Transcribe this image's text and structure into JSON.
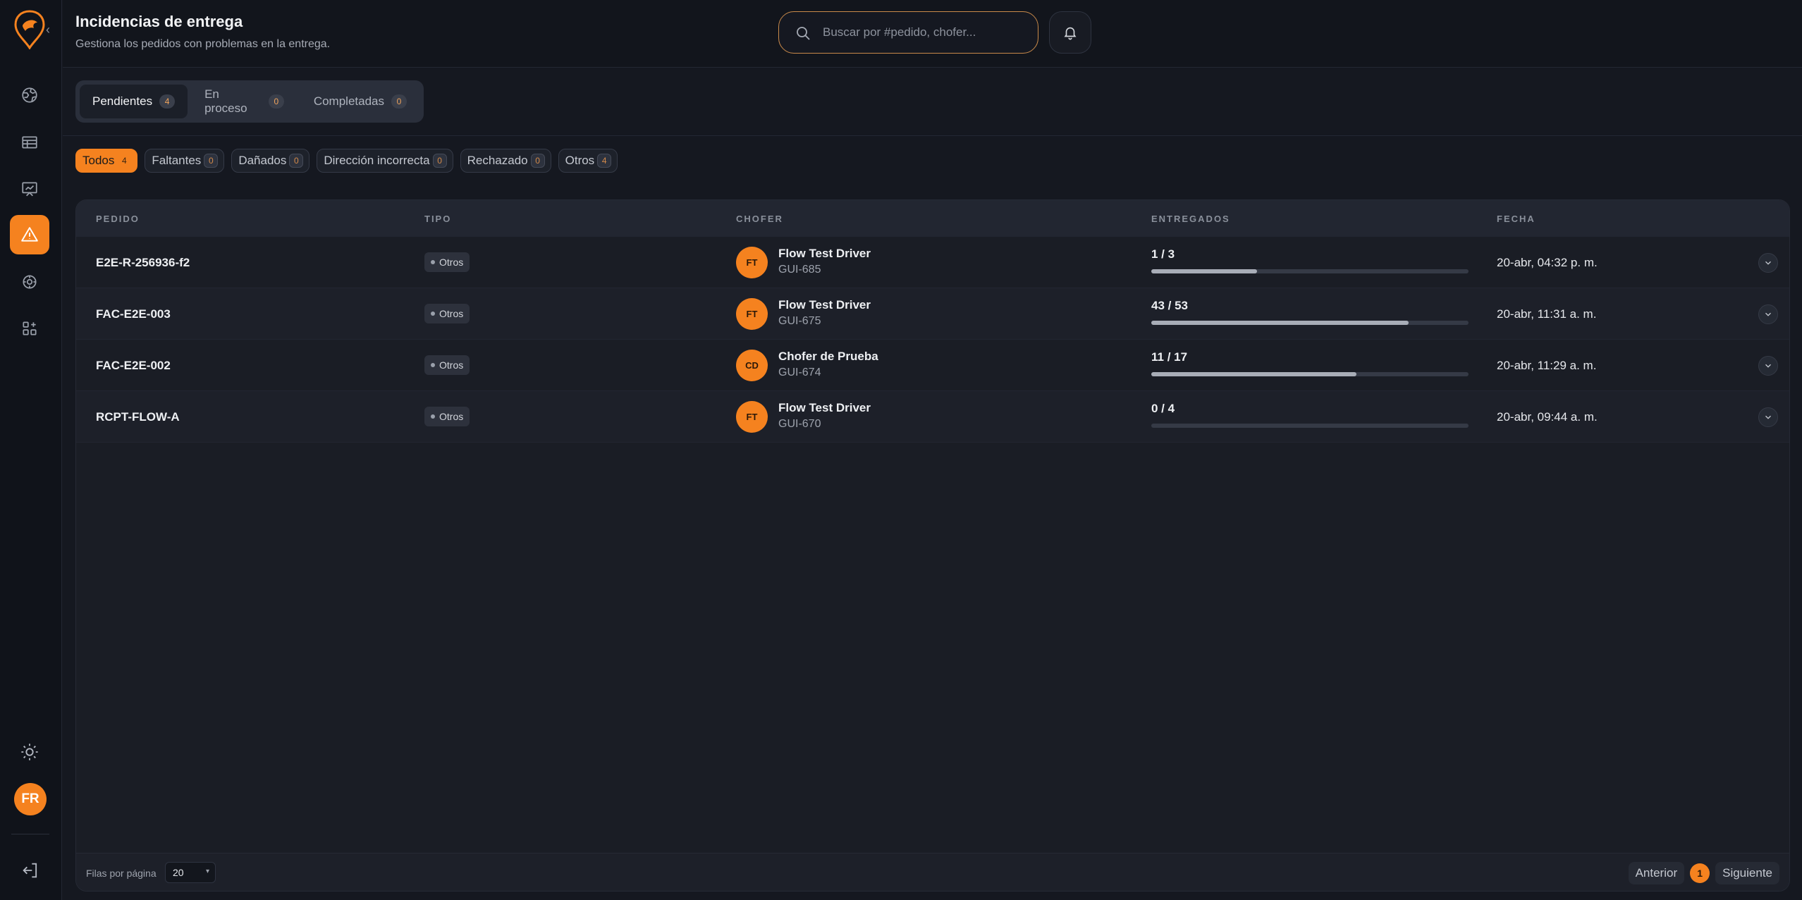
{
  "header": {
    "title": "Incidencias de entrega",
    "subtitle": "Gestiona los pedidos con problemas en la entrega.",
    "search_placeholder": "Buscar por #pedido, chofer..."
  },
  "sidebar": {
    "user_initials": "FR"
  },
  "tabs": [
    {
      "label": "Pendientes",
      "count": "4"
    },
    {
      "label": "En proceso",
      "count": "0"
    },
    {
      "label": "Completadas",
      "count": "0"
    }
  ],
  "filters": [
    {
      "label": "Todos",
      "count": "4"
    },
    {
      "label": "Faltantes",
      "count": "0"
    },
    {
      "label": "Dañados",
      "count": "0"
    },
    {
      "label": "Dirección incorrecta",
      "count": "0"
    },
    {
      "label": "Rechazado",
      "count": "0"
    },
    {
      "label": "Otros",
      "count": "4"
    }
  ],
  "table": {
    "columns": [
      "PEDIDO",
      "TIPO",
      "CHOFER",
      "ENTREGADOS",
      "FECHA"
    ],
    "rows": [
      {
        "order": "E2E-R-256936-f2",
        "type": "Otros",
        "initials": "FT",
        "driver": "Flow Test Driver",
        "code": "GUI-685",
        "delivered": "1 / 3",
        "progress": 0.333,
        "date": "20-abr, 04:32 p. m."
      },
      {
        "order": "FAC-E2E-003",
        "type": "Otros",
        "initials": "FT",
        "driver": "Flow Test Driver",
        "code": "GUI-675",
        "delivered": "43 / 53",
        "progress": 0.811,
        "date": "20-abr, 11:31 a. m."
      },
      {
        "order": "FAC-E2E-002",
        "type": "Otros",
        "initials": "CD",
        "driver": "Chofer de Prueba",
        "code": "GUI-674",
        "delivered": "11 / 17",
        "progress": 0.647,
        "date": "20-abr, 11:29 a. m."
      },
      {
        "order": "RCPT-FLOW-A",
        "type": "Otros",
        "initials": "FT",
        "driver": "Flow Test Driver",
        "code": "GUI-670",
        "delivered": "0 / 4",
        "progress": 0,
        "date": "20-abr, 09:44 a. m."
      }
    ]
  },
  "footer": {
    "rows_per_page_label": "Filas por página",
    "rows_per_page_value": "20",
    "prev_label": "Anterior",
    "current_page": "1",
    "next_label": "Siguiente"
  },
  "colors": {
    "accent": "#f5821f",
    "background": "#151820"
  }
}
